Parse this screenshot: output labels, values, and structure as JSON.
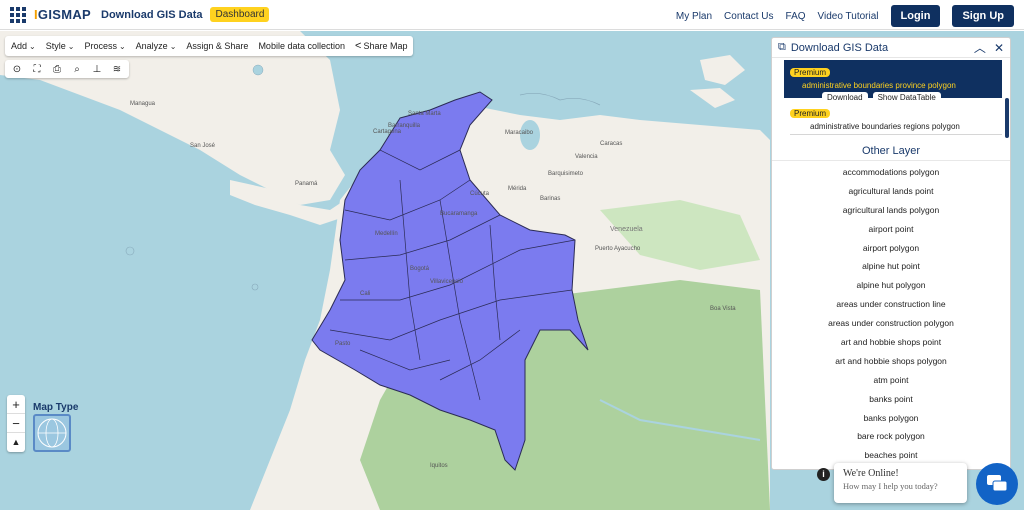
{
  "header": {
    "logo_prefix": "I",
    "logo_suffix": "GISMAP",
    "title": "Download GIS Data",
    "dashboard": "Dashboard",
    "nav": [
      "My Plan",
      "Contact Us",
      "FAQ",
      "Video Tutorial"
    ],
    "login": "Login",
    "signup": "Sign Up"
  },
  "toolbar": {
    "add": "Add",
    "style": "Style",
    "process": "Process",
    "analyze": "Analyze",
    "assign_share": "Assign & Share",
    "mobile": "Mobile data collection",
    "share_map": "Share Map"
  },
  "tools": [
    "locate-icon",
    "fullscreen-icon",
    "print-icon",
    "search-icon",
    "measure-icon",
    "layers-icon"
  ],
  "map_labels": [
    "Santa Marta",
    "Barranquilla",
    "Cartagena",
    "Maracaibo",
    "Caracas",
    "Valencia",
    "Barquisimeto",
    "Mérida",
    "Barinas",
    "Cúcuta",
    "Bucaramanga",
    "Medellín",
    "Bogotá",
    "Cali",
    "Pasto",
    "Venezuela",
    "Boa Vista",
    "Iquitos",
    "Panamá",
    "San José",
    "Managua",
    "Puerto Ayacucho",
    "Villavicencio"
  ],
  "map_type": "Map Type",
  "panel": {
    "title": "Download GIS Data",
    "selected": {
      "badge": "Premium",
      "name": "administrative boundaries province polygon",
      "download": "Download",
      "show_table": "Show DataTable"
    },
    "second": {
      "badge": "Premium",
      "name": "administrative boundaries regions polygon"
    },
    "other_title": "Other Layer",
    "other_layers": [
      "accommodations polygon",
      "agricultural lands point",
      "agricultural lands polygon",
      "airport point",
      "airport polygon",
      "alpine hut point",
      "alpine hut polygon",
      "areas under construction line",
      "areas under construction polygon",
      "art and hobbie shops point",
      "art and hobbie shops polygon",
      "atm point",
      "banks point",
      "banks polygon",
      "bare rock polygon",
      "beaches point"
    ]
  },
  "chat": {
    "line1": "We're Online!",
    "line2": "How may I help you today?"
  },
  "colors": {
    "navy": "#0f3060",
    "yellow": "#ffd21f",
    "sea": "#aad3df",
    "land": "#f2efe9",
    "forest": "#add19e",
    "colombia": "#7b7bef",
    "chat": "#1263c6"
  }
}
